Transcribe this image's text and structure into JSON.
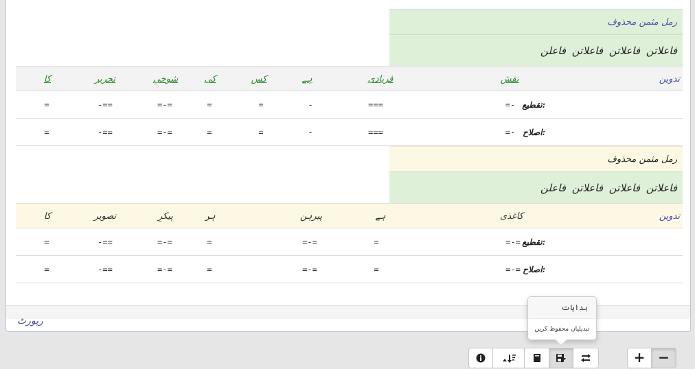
{
  "verse1": {
    "meter_name": "رمل مثمن محذوف",
    "meter_pattern": "فاعلاتن فاعلاتن فاعلاتن فاعلن",
    "tadween_label": "تدوین",
    "words": [
      "نقش",
      "فریادی",
      "ہے",
      "کس",
      "کی",
      "شوخیِ",
      "تحریر",
      "کا"
    ],
    "taqti_label": "تقطیع:",
    "taqti_symbols": [
      "=-",
      "===",
      "-",
      "=",
      "=",
      "=-=",
      "-==",
      "="
    ],
    "islah_label": "اصلاح:",
    "islah_symbols": [
      "=-",
      "===",
      "-",
      "=",
      "=",
      "=-=",
      "-==",
      "="
    ]
  },
  "verse2": {
    "meter_name": "رمل مثمن محذوف",
    "meter_pattern": "فاعلاتن فاعلاتن فاعلاتن فاعلن",
    "tadween_label": "تدوین",
    "words": [
      "کاغذی",
      "ہے",
      "پیرہن",
      "ہر",
      "پیکرِ",
      "تصویر",
      "کا"
    ],
    "taqti_label": "تقطیع:",
    "taqti_symbols": [
      "=-=",
      "=",
      "=-=",
      "=",
      "=-=",
      "-==",
      "="
    ],
    "islah_label": "اصلاح:",
    "islah_symbols": [
      "=-=",
      "=",
      "=-=",
      "=",
      "=-=",
      "-==",
      "="
    ]
  },
  "footer": {
    "report_link": "رپورٹ"
  },
  "popover": {
    "title": "ہدایات",
    "body": "تبدیلیاں محفوظ کریں"
  },
  "toolbar": {
    "info_icon": "info-icon",
    "sort_icon": "sort-icon",
    "book_icon": "book-icon",
    "save_icon": "save-icon",
    "swap_icon": "swap-icon",
    "zoom_in": "+",
    "zoom_out": "−"
  },
  "colors": {
    "green_bg": "#dff0d8",
    "yellow_bg": "#fcf8e3",
    "link_green": "#2e8b2e",
    "label_blue": "#4a4ab0"
  }
}
